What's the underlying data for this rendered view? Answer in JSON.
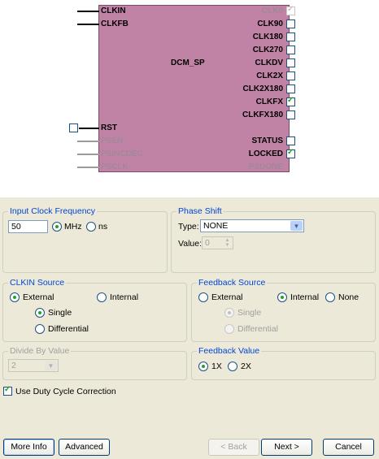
{
  "diagram": {
    "title": "DCM_SP",
    "inputs": {
      "clkin": "CLKIN",
      "clkfb": "CLKFB",
      "rst": "RST",
      "psen": "PSEN",
      "psincdec": "PSINCDEC",
      "psclk": "PSCLK"
    },
    "outputs": {
      "clk0": "CLK0",
      "clk90": "CLK90",
      "clk180": "CLK180",
      "clk270": "CLK270",
      "clkdv": "CLKDV",
      "clk2x": "CLK2X",
      "clk2x180": "CLK2X180",
      "clkfx": "CLKFX",
      "clkfx180": "CLKFX180",
      "status": "STATUS",
      "locked": "LOCKED",
      "psdone": "PSDONE"
    }
  },
  "input_clock": {
    "legend": "Input Clock Frequency",
    "value": "50",
    "mhz_label": "MHz",
    "ns_label": "ns"
  },
  "phase_shift": {
    "legend": "Phase Shift",
    "type_label": "Type:",
    "type_value": "NONE",
    "value_label": "Value:",
    "value_value": "0"
  },
  "clkin_source": {
    "legend": "CLKIN Source",
    "external_label": "External",
    "internal_label": "Internal",
    "single_label": "Single",
    "differential_label": "Differential"
  },
  "feedback_source": {
    "legend": "Feedback Source",
    "external_label": "External",
    "internal_label": "Internal",
    "none_label": "None",
    "single_label": "Single",
    "differential_label": "Differential"
  },
  "divide_by": {
    "legend": "Divide By Value",
    "value": "2"
  },
  "feedback_value": {
    "legend": "Feedback Value",
    "one_x_label": "1X",
    "two_x_label": "2X"
  },
  "duty_cycle": {
    "label": "Use Duty Cycle Correction"
  },
  "buttons": {
    "more_info": "More Info",
    "advanced": "Advanced",
    "back": "< Back",
    "next": "Next >",
    "cancel": "Cancel"
  },
  "colors": {
    "block_fill": "#c083a6",
    "legend_blue": "#0046d5",
    "check_green": "#21a121",
    "dialog_bg": "#ece9d8"
  }
}
